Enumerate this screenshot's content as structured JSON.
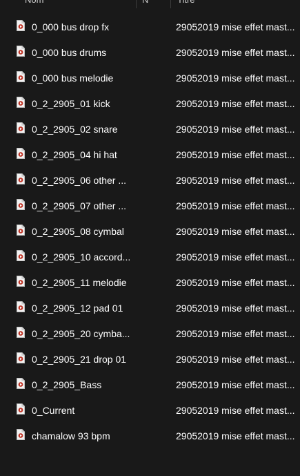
{
  "header": {
    "col_name": "Nom",
    "col_number": "N°",
    "col_title": "Titre"
  },
  "files": [
    {
      "name": "0_000 bus drop fx",
      "title": "29052019 mise effet mast..."
    },
    {
      "name": "0_000 bus drums",
      "title": "29052019 mise effet mast..."
    },
    {
      "name": "0_000 bus melodie",
      "title": "29052019 mise effet mast..."
    },
    {
      "name": "0_2_2905_01 kick",
      "title": "29052019 mise effet mast..."
    },
    {
      "name": "0_2_2905_02 snare",
      "title": "29052019 mise effet mast..."
    },
    {
      "name": "0_2_2905_04 hi hat",
      "title": "29052019 mise effet mast..."
    },
    {
      "name": "0_2_2905_06 other ...",
      "title": "29052019 mise effet mast..."
    },
    {
      "name": "0_2_2905_07 other ...",
      "title": "29052019 mise effet mast..."
    },
    {
      "name": "0_2_2905_08 cymbal",
      "title": "29052019 mise effet mast..."
    },
    {
      "name": "0_2_2905_10 accord...",
      "title": "29052019 mise effet mast..."
    },
    {
      "name": "0_2_2905_11 melodie",
      "title": "29052019 mise effet mast..."
    },
    {
      "name": "0_2_2905_12 pad 01",
      "title": "29052019 mise effet mast..."
    },
    {
      "name": "0_2_2905_20 cymba...",
      "title": "29052019 mise effet mast..."
    },
    {
      "name": "0_2_2905_21 drop 01",
      "title": "29052019 mise effet mast..."
    },
    {
      "name": "0_2_2905_Bass",
      "title": "29052019 mise effet mast..."
    },
    {
      "name": "0_Current",
      "title": "29052019 mise effet mast..."
    },
    {
      "name": "chamalow 93 bpm",
      "title": "29052019 mise effet mast..."
    }
  ],
  "icon": {
    "name": "audio-file-icon",
    "page_color": "#f2f2f2",
    "fold_color": "#bdbdbd",
    "play_color": "#c0392b"
  },
  "colors": {
    "background": "#191919",
    "text": "#ffffff",
    "header_text": "#cfcfcf",
    "separator": "#3b3b3b"
  }
}
